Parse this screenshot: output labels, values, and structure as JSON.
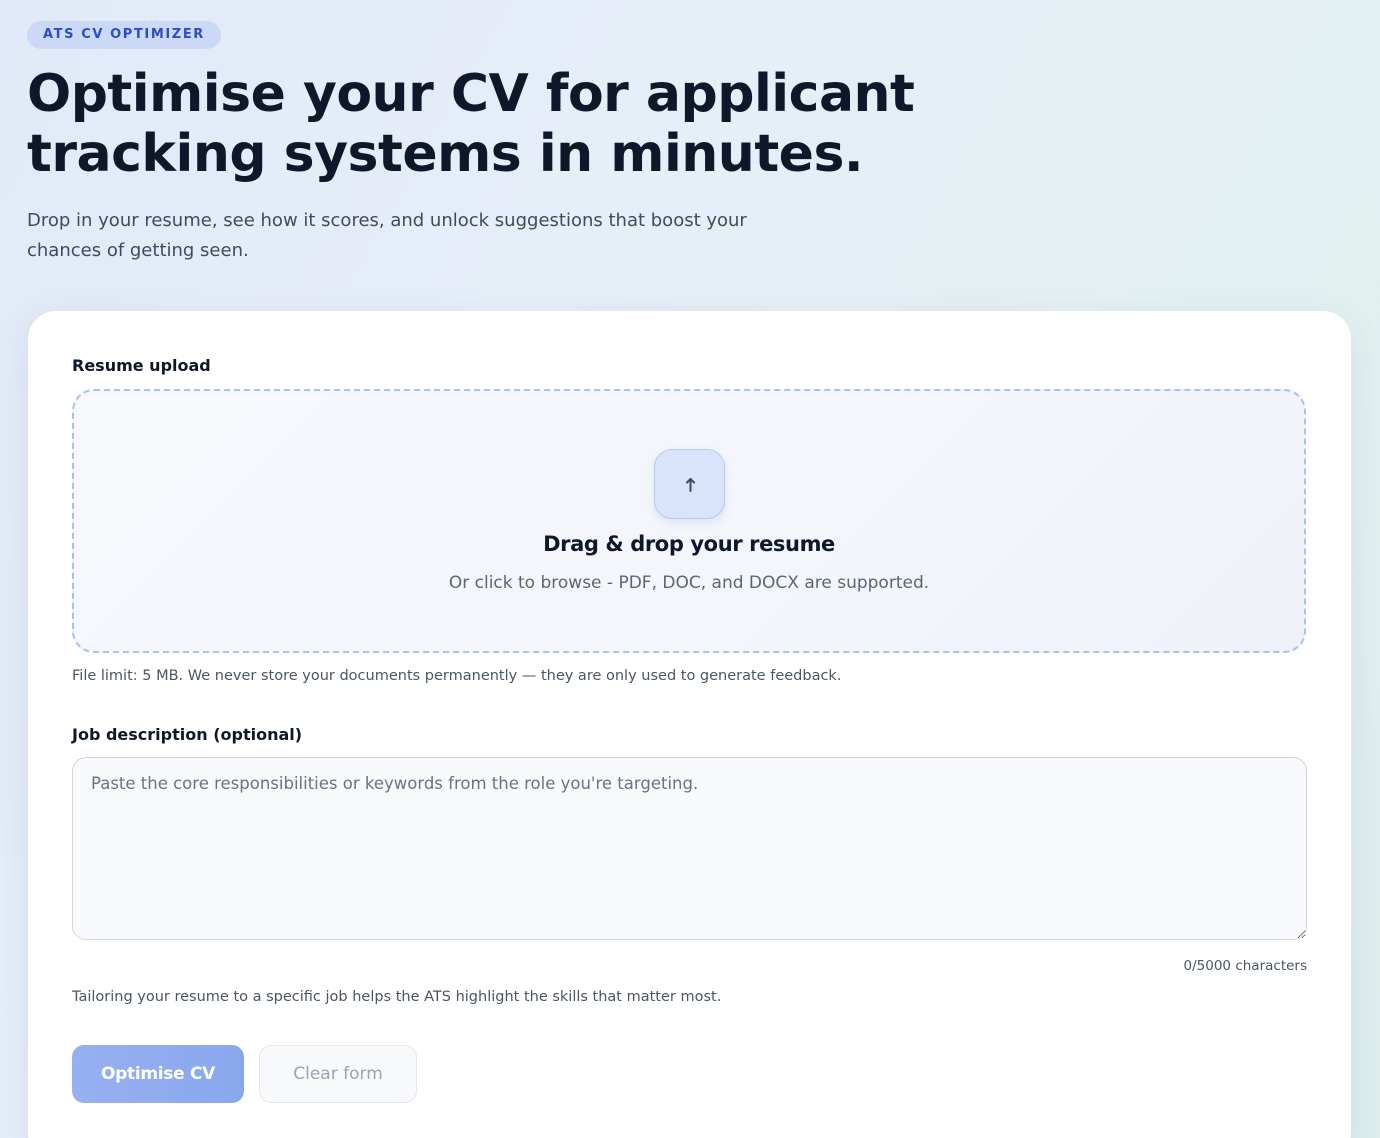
{
  "header": {
    "badge": "ATS CV OPTIMIZER",
    "title": "Optimise your CV for applicant tracking systems in minutes.",
    "subtitle": "Drop in your resume, see how it scores, and unlock suggestions that boost your chances of getting seen."
  },
  "upload": {
    "label": "Resume upload",
    "icon": "upload-arrow-icon",
    "title": "Drag & drop your resume",
    "subtitle": "Or click to browse - PDF, DOC, and DOCX are supported.",
    "helper": "File limit: 5 MB. We never store your documents permanently — they are only used to generate feedback."
  },
  "job_description": {
    "label": "Job description (optional)",
    "placeholder": "Paste the core responsibilities or keywords from the role you're targeting.",
    "value": "",
    "char_count": "0/5000 characters",
    "helper": "Tailoring your resume to a specific job helps the ATS highlight the skills that matter most."
  },
  "actions": {
    "primary_label": "Optimise CV",
    "secondary_label": "Clear form"
  },
  "colors": {
    "accent": "#8aa7ee",
    "badge_bg": "#ccd9f6",
    "badge_text": "#2c4fc0",
    "heading": "#0f172a"
  }
}
